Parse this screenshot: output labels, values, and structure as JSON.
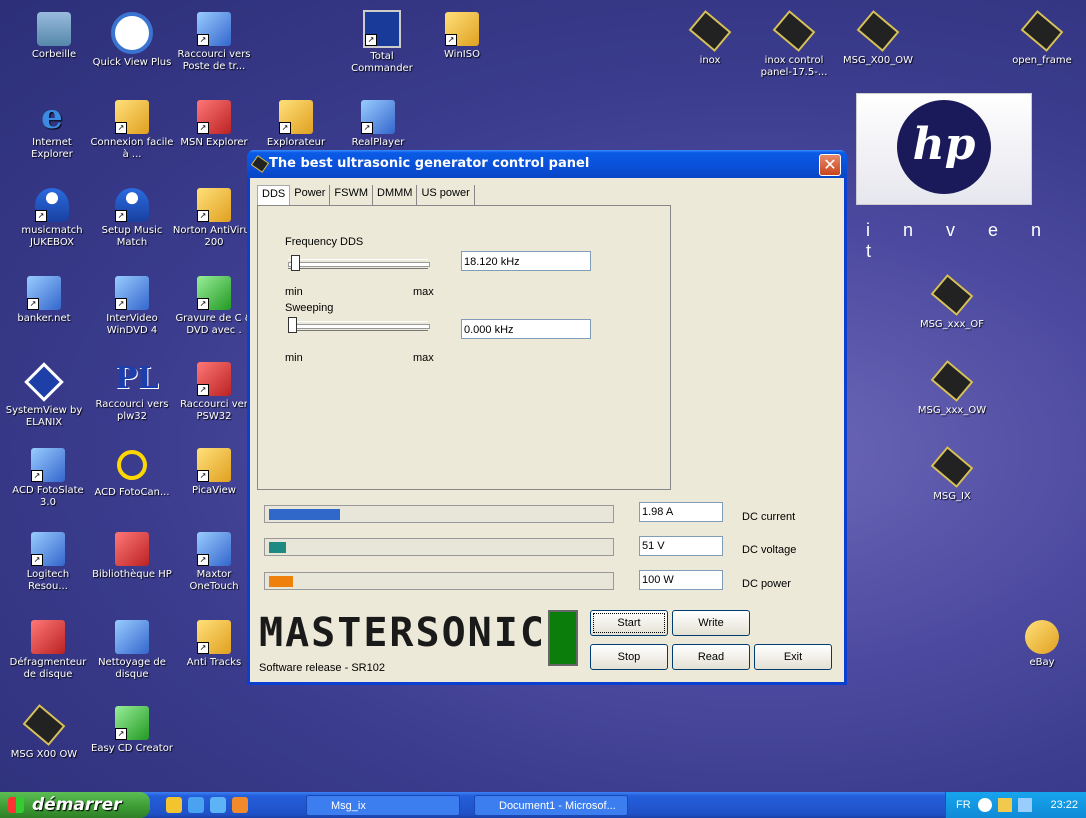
{
  "desktop": {
    "icons": [
      {
        "label": "Corbeille"
      },
      {
        "label": "Quick View Plus"
      },
      {
        "label": "Raccourci vers Poste de tr..."
      },
      {
        "label": "Total Commander"
      },
      {
        "label": "WinISO"
      },
      {
        "label": "inox"
      },
      {
        "label": "inox control panel-17.5-..."
      },
      {
        "label": "MSG_X00_OW"
      },
      {
        "label": "open_frame"
      },
      {
        "label": "Internet Explorer"
      },
      {
        "label": "Connexion facile à ..."
      },
      {
        "label": "MSN Explorer"
      },
      {
        "label": "Explorateur"
      },
      {
        "label": "RealPlayer"
      },
      {
        "label": "musicmatch JUKEBOX"
      },
      {
        "label": "Setup Music Match"
      },
      {
        "label": "Norton AntiVirus 200"
      },
      {
        "label": "banker.net"
      },
      {
        "label": "InterVideo WinDVD 4"
      },
      {
        "label": "Gravure de C & DVD avec ."
      },
      {
        "label": "MSG_xxx_OF"
      },
      {
        "label": "SystemView by ELANIX"
      },
      {
        "label": "Raccourci vers plw32"
      },
      {
        "label": "Raccourci ver PSW32"
      },
      {
        "label": "MSG_xxx_OW"
      },
      {
        "label": "ACD FotoSlate 3.0"
      },
      {
        "label": "ACD FotoCan..."
      },
      {
        "label": "PicaView"
      },
      {
        "label": "MSG_IX"
      },
      {
        "label": "Logitech Resou..."
      },
      {
        "label": "Bibliothèque HP"
      },
      {
        "label": "Maxtor OneTouch"
      },
      {
        "label": "Défragmenteur de disque"
      },
      {
        "label": "Nettoyage de disque"
      },
      {
        "label": "Anti Tracks"
      },
      {
        "label": "eBay"
      },
      {
        "label": "MSG X00 OW"
      },
      {
        "label": "Easy CD Creator"
      }
    ],
    "wallpaper": {
      "brand": "hp",
      "tagline": "i n v e n t"
    }
  },
  "window": {
    "title": "The best ultrasonic generator control panel",
    "close_glyph": "✕",
    "tabs": [
      "DDS",
      "Power",
      "FSWM",
      "DMMM",
      "US power"
    ],
    "active_tab": "DDS",
    "frequency": {
      "label": "Frequency DDS",
      "value": "18.120 kHz",
      "min": "min",
      "max": "max",
      "slider_fraction": 0.02
    },
    "sweeping": {
      "label": "Sweeping",
      "value": "0.000 kHz",
      "min": "min",
      "max": "max",
      "slider_fraction": 0.0
    },
    "gauges": [
      {
        "label": "DC current",
        "value": "1.98 A",
        "fraction": 0.21,
        "color": "#2f68c9"
      },
      {
        "label": "DC voltage",
        "value": "51 V",
        "fraction": 0.05,
        "color": "#1e8a82"
      },
      {
        "label": "DC power",
        "value": "100 W",
        "fraction": 0.07,
        "color": "#f0800c"
      }
    ],
    "logo": "MASTERSONIC",
    "release": "Software release - SR102",
    "buttons": {
      "start": "Start",
      "write": "Write",
      "stop": "Stop",
      "read": "Read",
      "exit": "Exit"
    },
    "indicator_color": "#0a7d0a"
  },
  "taskbar": {
    "start_label": "démarrer",
    "tasks": [
      "Msg_ix",
      "Document1 - Microsof..."
    ],
    "lang": "FR",
    "clock": "23:22"
  }
}
